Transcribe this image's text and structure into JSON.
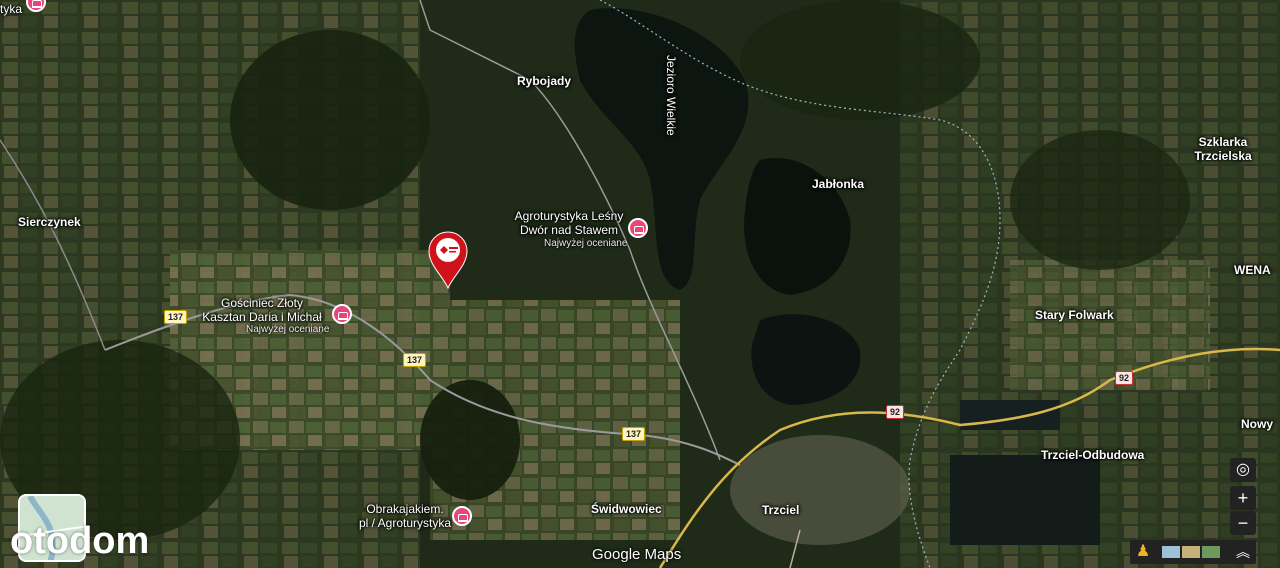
{
  "map": {
    "places": [
      {
        "id": "rybojady",
        "label": "Rybojady"
      },
      {
        "id": "jezioro",
        "label": "Jezioro Wielkie"
      },
      {
        "id": "jablonka",
        "label": "Jabłonka"
      },
      {
        "id": "szklarka",
        "label": "Szklarka Trzcielska"
      },
      {
        "id": "sierczynek",
        "label": "Sierczynek"
      },
      {
        "id": "wena",
        "label": "WENA"
      },
      {
        "id": "stary-folwark",
        "label": "Stary Folwark"
      },
      {
        "id": "nowy",
        "label": "Nowy"
      },
      {
        "id": "trzciel-odbudowa",
        "label": "Trzciel-Odbudowa"
      },
      {
        "id": "swidwowiec",
        "label": "Świdwowiec"
      },
      {
        "id": "trzciel",
        "label": "Trzciel"
      },
      {
        "id": "tyka",
        "label": "tyka"
      }
    ],
    "pois": [
      {
        "id": "lesny-dwor",
        "line1": "Agroturystyka Leśny",
        "line2": "Dwór nad Stawem",
        "sub": "Najwyżej oceniane"
      },
      {
        "id": "gosciniec",
        "line1": "Gościniec Złoty",
        "line2": "Kasztan Daria i Michał",
        "sub": "Najwyżej oceniane"
      },
      {
        "id": "obrakajakiem",
        "line1": "Obrakajakiem.",
        "line2": "pl / Agroturystyka",
        "sub": ""
      }
    ],
    "roads": [
      {
        "id": "r137a",
        "label": "137"
      },
      {
        "id": "r137b",
        "label": "137"
      },
      {
        "id": "r137c",
        "label": "137"
      },
      {
        "id": "r92a",
        "label": "92"
      },
      {
        "id": "r92b",
        "label": "92"
      }
    ],
    "marker": {
      "icon": "property-pin-icon",
      "color": "#d0121b"
    }
  },
  "branding": {
    "otodom": "otodom",
    "google": "Google Maps"
  },
  "controls": {
    "locate_icon": "my-location-icon",
    "zoom_in": "+",
    "zoom_out": "−",
    "pegman_icon": "pegman-icon",
    "expand_icon": "chevron-up-icon"
  }
}
